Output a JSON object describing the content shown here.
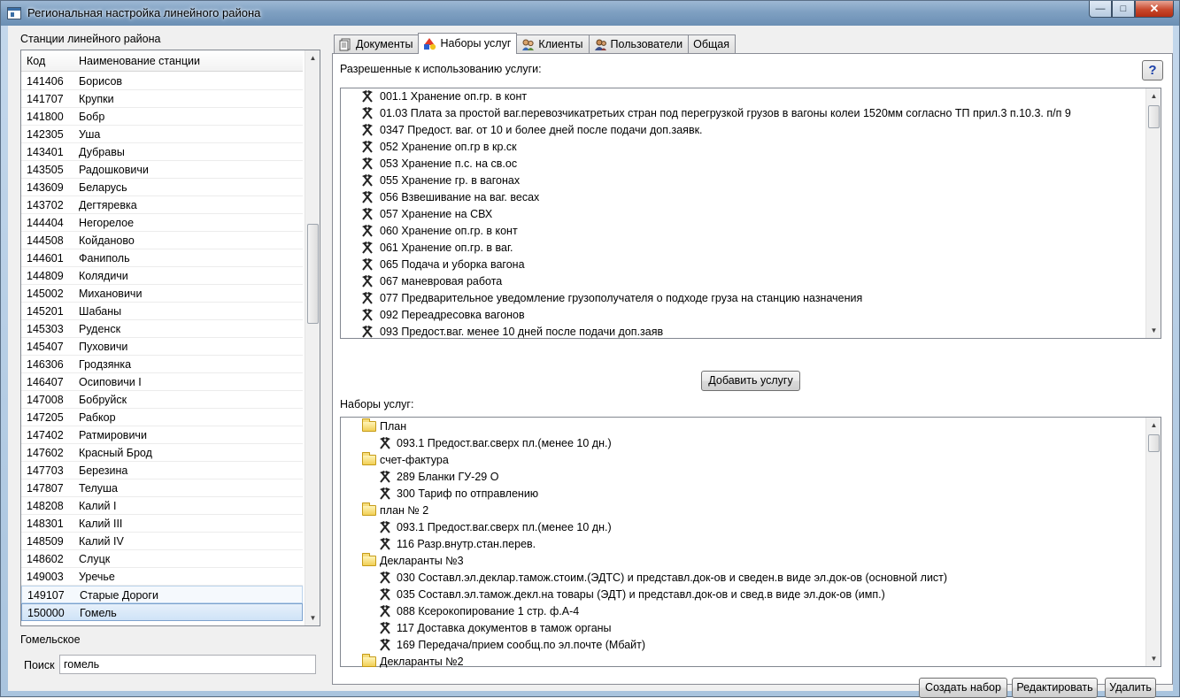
{
  "window": {
    "title": "Региональная настройка линейного района"
  },
  "stations": {
    "label": "Станции линейного района",
    "columns": {
      "code": "Код",
      "name": "Наименование станции"
    },
    "rows": [
      {
        "code": "141406",
        "name": "Борисов"
      },
      {
        "code": "141707",
        "name": "Крупки"
      },
      {
        "code": "141800",
        "name": "Бобр"
      },
      {
        "code": "142305",
        "name": "Уша"
      },
      {
        "code": "143401",
        "name": "Дубравы"
      },
      {
        "code": "143505",
        "name": "Радошковичи"
      },
      {
        "code": "143609",
        "name": "Беларусь"
      },
      {
        "code": "143702",
        "name": "Дегтяревка"
      },
      {
        "code": "144404",
        "name": "Негорелое"
      },
      {
        "code": "144508",
        "name": "Койданово"
      },
      {
        "code": "144601",
        "name": "Фаниполь"
      },
      {
        "code": "144809",
        "name": "Колядичи"
      },
      {
        "code": "145002",
        "name": "Михановичи"
      },
      {
        "code": "145201",
        "name": "Шабаны"
      },
      {
        "code": "145303",
        "name": "Руденск"
      },
      {
        "code": "145407",
        "name": "Пуховичи"
      },
      {
        "code": "146306",
        "name": "Гродзянка"
      },
      {
        "code": "146407",
        "name": "Осиповичи I"
      },
      {
        "code": "147008",
        "name": "Бобруйск"
      },
      {
        "code": "147205",
        "name": "Рабкор"
      },
      {
        "code": "147402",
        "name": "Ратмировичи"
      },
      {
        "code": "147602",
        "name": "Красный Брод"
      },
      {
        "code": "147703",
        "name": "Березина"
      },
      {
        "code": "147807",
        "name": "Телуша"
      },
      {
        "code": "148208",
        "name": "Калий I"
      },
      {
        "code": "148301",
        "name": "Калий III"
      },
      {
        "code": "148509",
        "name": "Калий IV"
      },
      {
        "code": "148602",
        "name": "Слуцк"
      },
      {
        "code": "149003",
        "name": "Уречье"
      },
      {
        "code": "149107",
        "name": "Старые Дороги"
      },
      {
        "code": "150000",
        "name": "Гомель"
      }
    ],
    "region": "Гомельское",
    "search_label": "Поиск",
    "search_value": "гомель"
  },
  "tabs": [
    {
      "label": "Документы",
      "icon": "documents-icon"
    },
    {
      "label": "Наборы услуг",
      "icon": "service-sets-icon"
    },
    {
      "label": "Клиенты",
      "icon": "clients-icon"
    },
    {
      "label": "Пользователи",
      "icon": "users-icon"
    },
    {
      "label": "Общая"
    }
  ],
  "active_tab": "Наборы услуг",
  "allowed": {
    "label": "Разрешенные к использованию услуги:",
    "help": "?",
    "items": [
      "001.1 Хранение оп.гр. в конт",
      "01.03 Плата за простой ваг.перевозчикатретьих стран под перегрузкой грузов в вагоны колеи 1520мм согласно ТП прил.3 п.10.3. п/п 9",
      "0347 Предост. ваг. от 10 и более дней после подачи доп.заявк.",
      "052 Хранение оп.гр в кр.ск",
      "053 Хранение п.с. на св.ос",
      "055 Хранение гр. в вагонах",
      "056 Взвешивание на ваг. весах",
      "057 Хранение на СВХ",
      "060 Хранение оп.гр. в конт",
      "061 Хранение оп.гр. в ваг.",
      "065 Подача и уборка вагона",
      "067 маневровая работа",
      "077 Предварительное уведомление грузополучателя о подходе груза на станцию назначения",
      "092 Переадресовка вагонов",
      "093 Предост.ваг. менее 10 дней после подачи доп.заяв"
    ],
    "add_button": "Добавить услугу"
  },
  "sets": {
    "label": "Наборы услуг:",
    "tree": [
      {
        "type": "folder",
        "text": "План"
      },
      {
        "type": "service",
        "text": "093.1 Предост.ваг.сверх пл.(менее 10 дн.)"
      },
      {
        "type": "folder",
        "text": "счет-фактура"
      },
      {
        "type": "service",
        "text": "289 Бланки ГУ-29 О"
      },
      {
        "type": "service",
        "text": "300 Тариф по отправлению"
      },
      {
        "type": "folder",
        "text": "план № 2"
      },
      {
        "type": "service",
        "text": "093.1 Предост.ваг.сверх пл.(менее 10 дн.)"
      },
      {
        "type": "service",
        "text": "116 Разр.внутр.стан.перев."
      },
      {
        "type": "folder",
        "text": "Декларанты №3"
      },
      {
        "type": "service",
        "text": "030 Составл.эл.деклар.тамож.стоим.(ЭДТС) и представл.док-ов и сведен.в виде эл.док-ов (основной лист)"
      },
      {
        "type": "service",
        "text": "035 Составл.эл.тамож.декл.на товары (ЭДТ) и представл.док-ов и свед.в виде эл.док-ов (имп.)"
      },
      {
        "type": "service",
        "text": "088 Ксерокопирование 1 стр. ф.А-4"
      },
      {
        "type": "service",
        "text": "117 Доставка документов в тамож органы"
      },
      {
        "type": "service",
        "text": "169 Передача/прием сообщ.по эл.почте (Мбайт)"
      },
      {
        "type": "folder",
        "text": "Декларанты №2"
      }
    ],
    "buttons": {
      "create": "Создать набор",
      "edit": "Редактировать",
      "delete": "Удалить"
    }
  }
}
